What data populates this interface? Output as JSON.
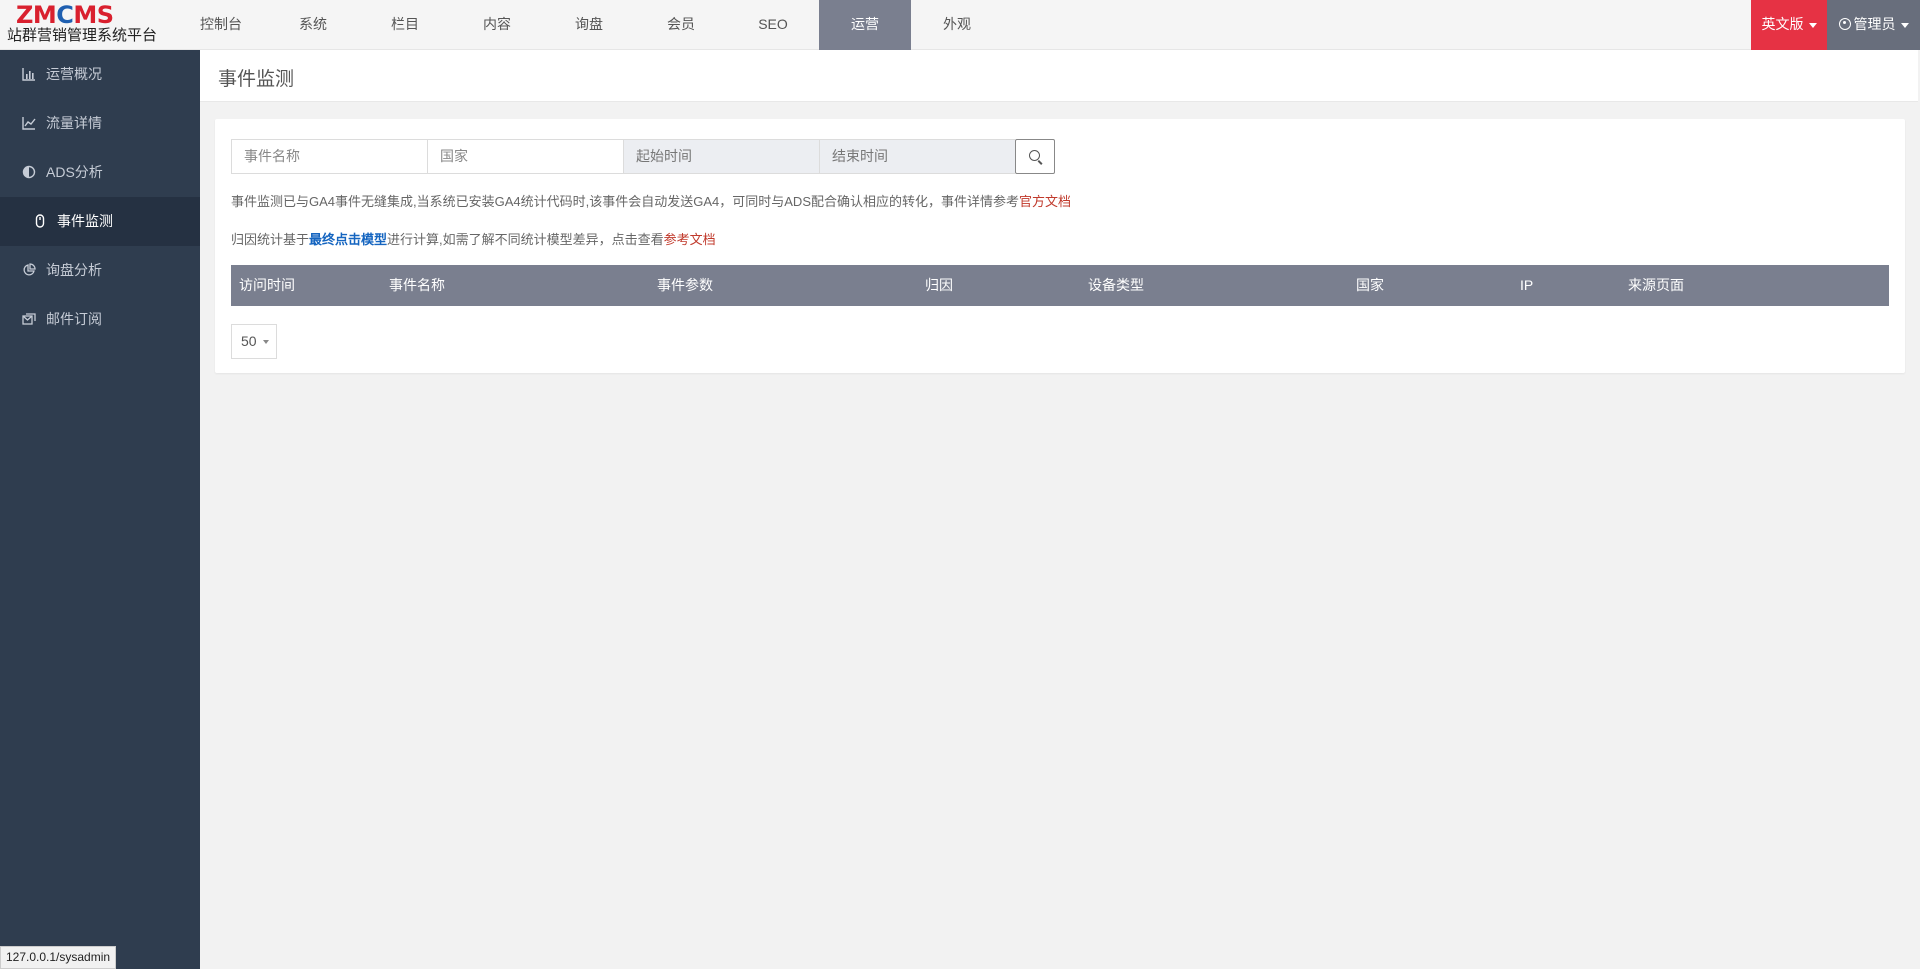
{
  "logo": {
    "mark_z": "ZM",
    "mark_c": "C",
    "mark_ms": "MS",
    "subtitle": "站群营销管理系统平台"
  },
  "topnav": {
    "items": [
      "控制台",
      "系统",
      "栏目",
      "内容",
      "询盘",
      "会员",
      "SEO",
      "运营",
      "外观"
    ],
    "active": "运营"
  },
  "lang_button": "英文版",
  "admin_button": "管理员",
  "sidebar": {
    "items": [
      "运营概况",
      "流量详情",
      "ADS分析",
      "事件监测",
      "询盘分析",
      "邮件订阅"
    ],
    "active": "事件监测"
  },
  "page_title": "事件监测",
  "search": {
    "event_name_placeholder": "事件名称",
    "country_placeholder": "国家",
    "start_time_placeholder": "起始时间",
    "end_time_placeholder": "结束时间"
  },
  "notes": {
    "note1_text": "事件监测已与GA4事件无缝集成,当系统已安装GA4统计代码时,该事件会自动发送GA4，可同时与ADS配合确认相应的转化，事件详情参考",
    "note1_link": "官方文档",
    "note2_prefix": "归因统计基于",
    "note2_bold_link": "最终点击模型",
    "note2_middle": "进行计算,如需了解不同统计模型差异，点击查看",
    "note2_link": "参考文档"
  },
  "table": {
    "columns": [
      "访问时间",
      "事件名称",
      "事件参数",
      "归因",
      "设备类型",
      "国家",
      "IP",
      "来源页面"
    ]
  },
  "pager": {
    "page_size": "50"
  },
  "status_bar": "127.0.0.1/sysadmin",
  "colors": {
    "brand_red": "#e63244",
    "sidebar_bg": "#2f3d4f",
    "active_nav": "#7a7f8f",
    "link_red": "#c0392b",
    "link_blue": "#1565c0"
  }
}
